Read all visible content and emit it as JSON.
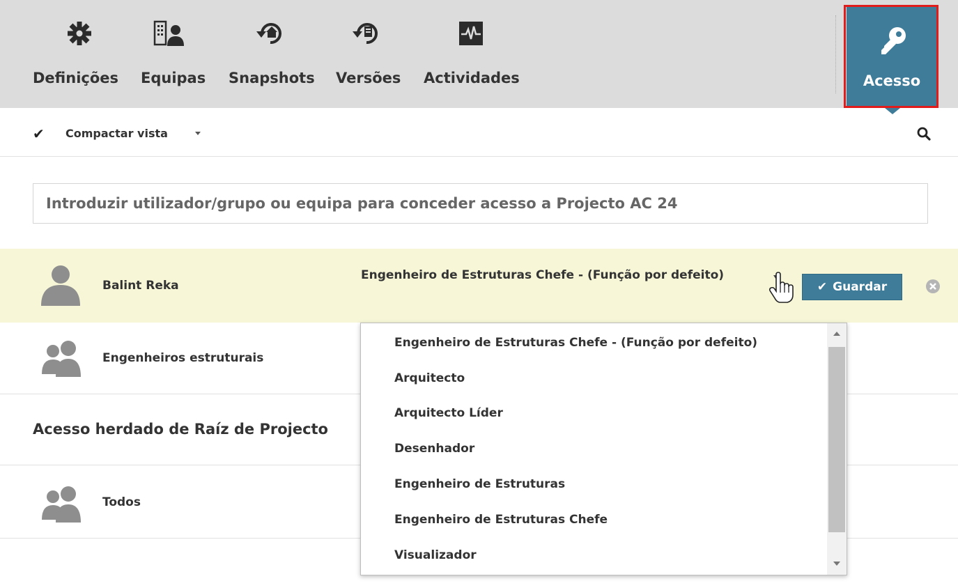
{
  "toolbar": {
    "tabs": [
      {
        "label": "Definições",
        "icon": "gear-icon"
      },
      {
        "label": "Equipas",
        "icon": "team-icon"
      },
      {
        "label": "Snapshots",
        "icon": "snapshot-icon"
      },
      {
        "label": "Versões",
        "icon": "versions-icon"
      },
      {
        "label": "Actividades",
        "icon": "activity-icon"
      }
    ],
    "active": {
      "label": "Acesso",
      "icon": "key-icon"
    }
  },
  "filter": {
    "compact_label": "Compactar vista"
  },
  "grant_input": {
    "placeholder": "Introduzir utilizador/grupo ou equipa para conceder acesso a Projecto AC 24"
  },
  "entries": [
    {
      "name": "Balint Reka",
      "type": "user",
      "role": "Engenheiro de Estruturas Chefe - (Função por defeito)",
      "save_label": "Guardar"
    },
    {
      "name": "Engenheiros estruturais",
      "type": "group"
    }
  ],
  "inherited": {
    "header": "Acesso herdado de Raíz de Projecto",
    "entries": [
      {
        "name": "Todos",
        "type": "group"
      }
    ]
  },
  "role_dropdown": {
    "options": [
      "Engenheiro de Estruturas Chefe - (Função por defeito)",
      "Arquitecto",
      "Arquitecto Líder",
      "Desenhador",
      "Engenheiro de Estruturas",
      "Engenheiro de Estruturas Chefe",
      "Visualizador"
    ]
  },
  "colors": {
    "accent": "#3e7c99",
    "highlight_row": "#f7f7d8",
    "toolbar_bg": "#dcdcdc",
    "outline": "#e21b1b"
  }
}
